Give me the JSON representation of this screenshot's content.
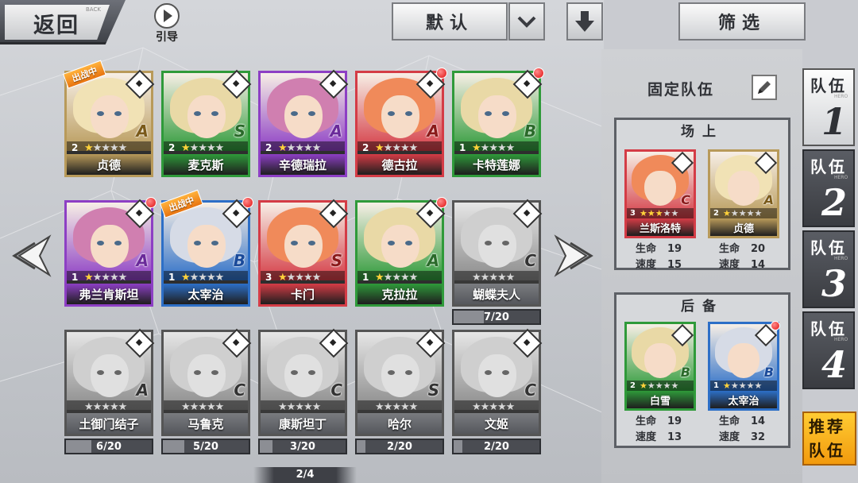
{
  "header": {
    "back_label": "返回",
    "back_sub": "BACK",
    "guide_label": "引导",
    "sort_label": "默认",
    "filter_label": "筛选"
  },
  "colors": {
    "purple": "#8d3fc4",
    "green": "#2f9a3a",
    "blue": "#2d6fc7",
    "red": "#d43c46",
    "gold": "#c79a2a",
    "tag_orange": "#f08a1c",
    "notify_red": "#e01010"
  },
  "heroes": [
    {
      "name": "贞德",
      "level": "2",
      "stars": 1,
      "rank": "A",
      "color": "gold",
      "tag": "出战中",
      "dot": false,
      "gray": false
    },
    {
      "name": "麦克斯",
      "level": "2",
      "stars": 1,
      "rank": "S",
      "color": "green",
      "tag": "",
      "dot": false,
      "gray": false
    },
    {
      "name": "辛德瑞拉",
      "level": "2",
      "stars": 1,
      "rank": "A",
      "color": "purple",
      "tag": "",
      "dot": false,
      "gray": false
    },
    {
      "name": "德古拉",
      "level": "2",
      "stars": 1,
      "rank": "A",
      "color": "red",
      "tag": "",
      "dot": true,
      "gray": false
    },
    {
      "name": "卡特莲娜",
      "level": "1",
      "stars": 1,
      "rank": "B",
      "color": "green",
      "tag": "",
      "dot": true,
      "gray": false
    },
    {
      "name": "弗兰肯斯坦",
      "level": "1",
      "stars": 1,
      "rank": "A",
      "color": "purple",
      "tag": "",
      "dot": true,
      "gray": false
    },
    {
      "name": "太宰治",
      "level": "1",
      "stars": 1,
      "rank": "B",
      "color": "blue",
      "tag": "出战中",
      "dot": true,
      "gray": false
    },
    {
      "name": "卡门",
      "level": "3",
      "stars": 1,
      "rank": "S",
      "color": "red",
      "tag": "",
      "dot": false,
      "gray": false
    },
    {
      "name": "克拉拉",
      "level": "1",
      "stars": 1,
      "rank": "A",
      "color": "green",
      "tag": "",
      "dot": true,
      "gray": false
    },
    {
      "name": "蝴蝶夫人",
      "level": "",
      "stars": 0,
      "rank": "C",
      "color": "gray",
      "tag": "",
      "dot": false,
      "gray": true,
      "progress": "7/20",
      "frac": 0.35
    },
    {
      "name": "土御门结子",
      "level": "",
      "stars": 0,
      "rank": "A",
      "color": "gray",
      "tag": "",
      "dot": false,
      "gray": true,
      "progress": "6/20",
      "frac": 0.3
    },
    {
      "name": "马鲁克",
      "level": "",
      "stars": 0,
      "rank": "C",
      "color": "gray",
      "tag": "",
      "dot": false,
      "gray": true,
      "progress": "5/20",
      "frac": 0.25
    },
    {
      "name": "康斯坦丁",
      "level": "",
      "stars": 0,
      "rank": "C",
      "color": "gray",
      "tag": "",
      "dot": false,
      "gray": true,
      "progress": "3/20",
      "frac": 0.15
    },
    {
      "name": "哈尔",
      "level": "",
      "stars": 0,
      "rank": "S",
      "color": "gray",
      "tag": "",
      "dot": false,
      "gray": true,
      "progress": "2/20",
      "frac": 0.1
    },
    {
      "name": "文姬",
      "level": "",
      "stars": 0,
      "rank": "C",
      "color": "gray",
      "tag": "",
      "dot": false,
      "gray": true,
      "progress": "2/20",
      "frac": 0.1
    }
  ],
  "pager": "2/4",
  "panel": {
    "title": "固定队伍",
    "front_label": "场上",
    "back_label": "后备",
    "hp_label": "生命",
    "speed_label": "速度",
    "front": [
      {
        "name": "兰斯洛特",
        "level": "3",
        "stars": 3,
        "rank": "C",
        "color": "red",
        "hp": "19",
        "speed": "15",
        "dot": false
      },
      {
        "name": "贞德",
        "level": "2",
        "stars": 1,
        "rank": "A",
        "color": "gold",
        "hp": "20",
        "speed": "14",
        "dot": false
      }
    ],
    "reserve": [
      {
        "name": "白雪",
        "level": "2",
        "stars": 1,
        "rank": "B",
        "color": "green",
        "hp": "19",
        "speed": "13",
        "dot": false
      },
      {
        "name": "太宰治",
        "level": "1",
        "stars": 1,
        "rank": "B",
        "color": "blue",
        "hp": "14",
        "speed": "32",
        "dot": true
      }
    ]
  },
  "team_tabs": [
    {
      "label": "队伍",
      "en": "HERO",
      "num": "1",
      "active": true
    },
    {
      "label": "队伍",
      "en": "HERO",
      "num": "2",
      "active": false
    },
    {
      "label": "队伍",
      "en": "HERO",
      "num": "3",
      "active": false
    },
    {
      "label": "队伍",
      "en": "HERO",
      "num": "4",
      "active": false
    }
  ],
  "recommend_label": "推荐队伍"
}
